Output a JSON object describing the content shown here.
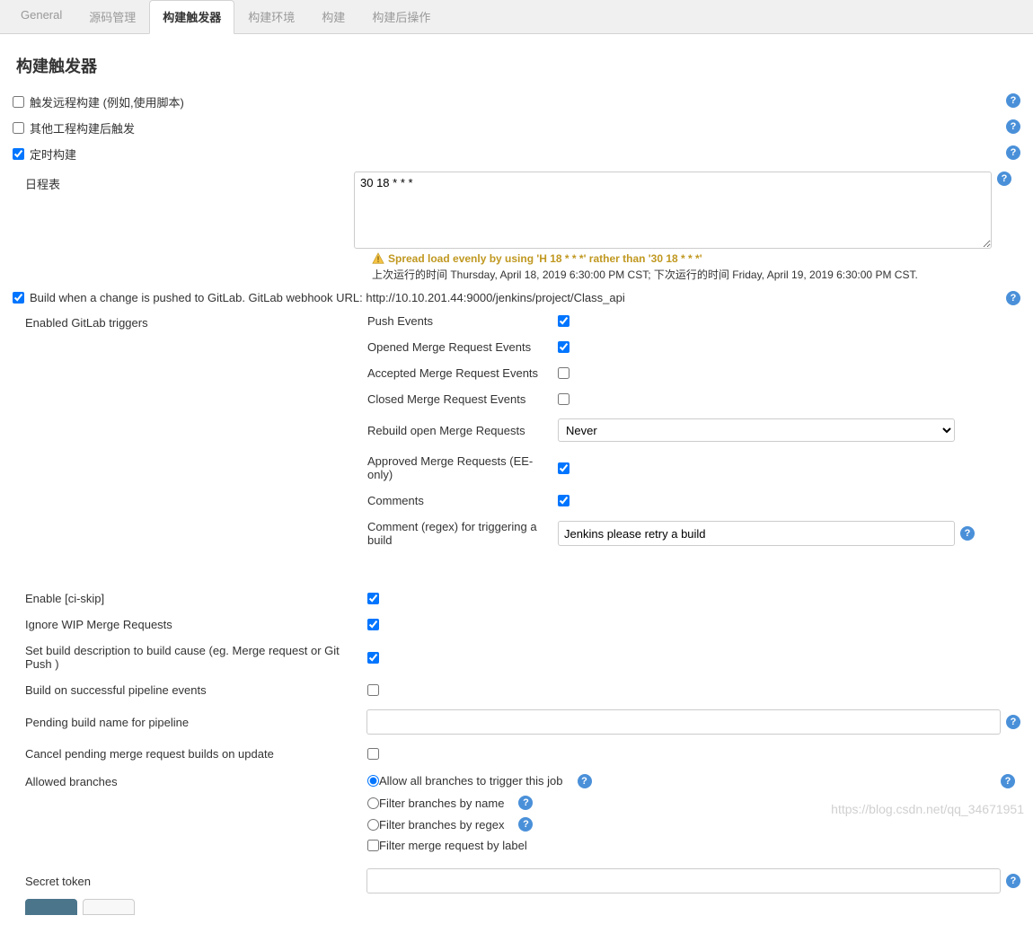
{
  "tabs": {
    "general": "General",
    "scm": "源码管理",
    "triggers": "构建触发器",
    "environment": "构建环境",
    "build": "构建",
    "postbuild": "构建后操作"
  },
  "section_title": "构建触发器",
  "trigger_remote": "触发远程构建 (例如,使用脚本)",
  "trigger_after_other": "其他工程构建后触发",
  "trigger_timer": "定时构建",
  "schedule_label": "日程表",
  "schedule_value": "30 18 * * *",
  "warning_text": "Spread load evenly by using 'H 18 * * *' rather than '30 18 * * *'",
  "run_info": "上次运行的时间 Thursday, April 18, 2019 6:30:00 PM CST; 下次运行的时间 Friday, April 19, 2019 6:30:00 PM CST.",
  "gitlab_push_label": "Build when a change is pushed to GitLab. GitLab webhook URL: http://10.10.201.44:9000/jenkins/project/Class_api",
  "enabled_triggers_label": "Enabled GitLab triggers",
  "sub": {
    "push_events": "Push Events",
    "opened_mr": "Opened Merge Request Events",
    "accepted_mr": "Accepted Merge Request Events",
    "closed_mr": "Closed Merge Request Events",
    "rebuild_open_mr": "Rebuild open Merge Requests",
    "rebuild_value": "Never",
    "approved_mr": "Approved Merge Requests (EE-only)",
    "comments": "Comments",
    "comment_regex_label": "Comment (regex) for triggering a build",
    "comment_regex_value": "Jenkins please retry a build"
  },
  "extras": {
    "ci_skip": "Enable [ci-skip]",
    "ignore_wip": "Ignore WIP Merge Requests",
    "set_desc": "Set build description to build cause (eg. Merge request or Git Push )",
    "build_on_pipeline": "Build on successful pipeline events",
    "pending_name": "Pending build name for pipeline",
    "pending_name_value": "",
    "cancel_pending": "Cancel pending merge request builds on update",
    "allowed_branches": "Allowed branches"
  },
  "branch_options": {
    "allow_all": "Allow all branches to trigger this job",
    "filter_name": "Filter branches by name",
    "filter_regex": "Filter branches by regex",
    "filter_label": "Filter merge request by label"
  },
  "secret_token_label": "Secret token",
  "secret_token_value": "",
  "watermark": "https://blog.csdn.net/qq_34671951"
}
